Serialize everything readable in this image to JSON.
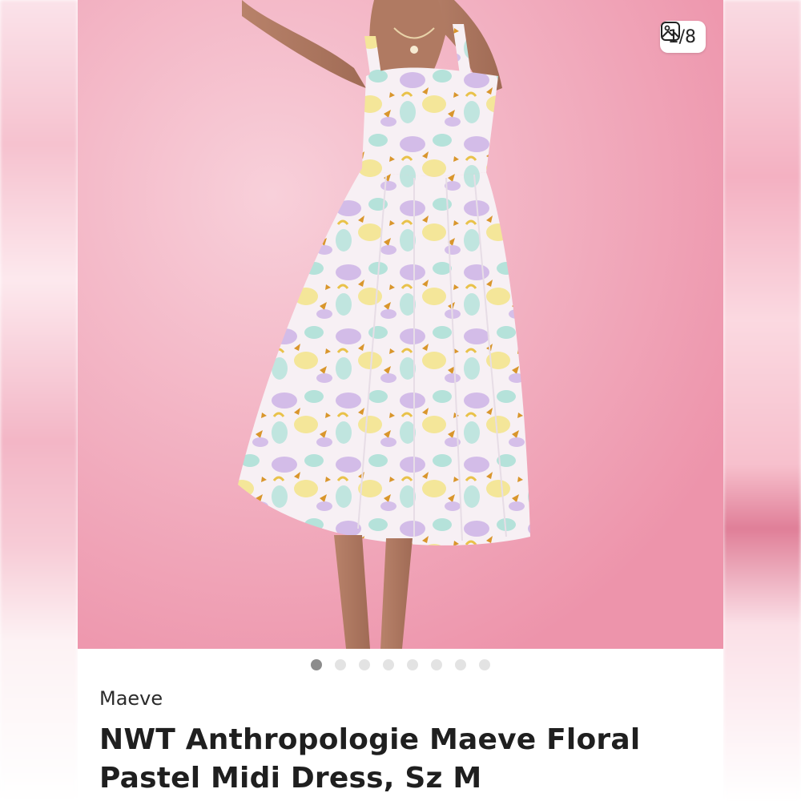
{
  "listing": {
    "image_counter": "1/8",
    "counter_icon": "image-gallery-icon",
    "carousel": {
      "total": 8,
      "active_index": 0
    },
    "brand": "Maeve",
    "title_line1": "NWT Anthropologie Maeve Floral",
    "title_line2": "Pastel Midi Dress, Sz M"
  },
  "colors": {
    "photo_background": "#f4adc0",
    "dot_active": "#8c8c8c",
    "dot_inactive": "#e3e3e3",
    "text": "#1f1f1f"
  }
}
